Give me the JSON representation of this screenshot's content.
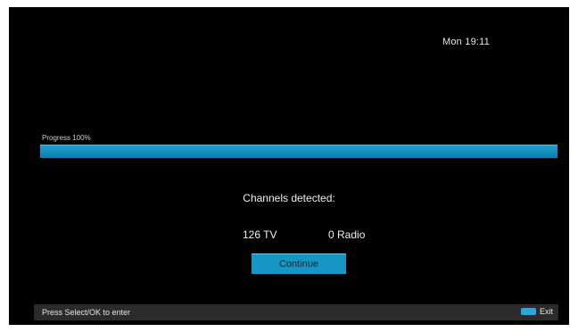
{
  "status_bar": {
    "clock": "Mon 19:11"
  },
  "progress": {
    "label": "Progress 100%",
    "value": 1.0,
    "fill_color": "#1798c8"
  },
  "scan_result": {
    "title": "Channels detected:",
    "tv": "126 TV",
    "radio": "0 Radio"
  },
  "actions": {
    "continue_label": "Continue"
  },
  "footer": {
    "hint": "Press Select/OK to enter",
    "exit_icon": "blue-key-icon",
    "exit_label": "Exit"
  }
}
